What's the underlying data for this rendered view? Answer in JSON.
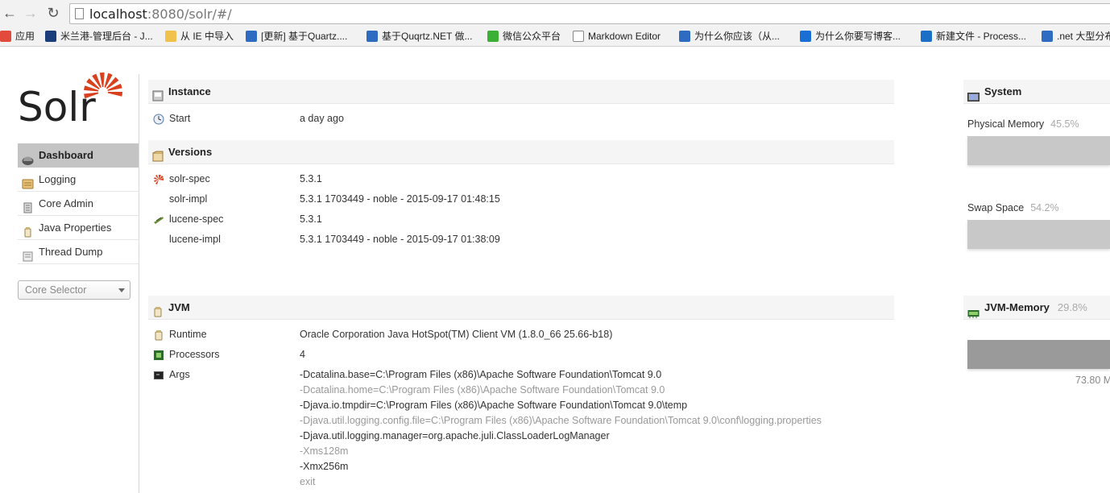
{
  "browser": {
    "url_host": "localhost",
    "url_rest": ":8080/solr/#/",
    "bookmarks": [
      {
        "label": "应用",
        "color": "#e24b3b"
      },
      {
        "label": "米兰港-管理后台 - J...",
        "color": "#1b3d7a"
      },
      {
        "label": "从 IE 中导入",
        "color": "#f0c14b"
      },
      {
        "label": "[更新] 基于Quartz....",
        "color": "#2d6cc0"
      },
      {
        "label": "基于Quqrtz.NET 做...",
        "color": "#2d6cc0"
      },
      {
        "label": "微信公众平台",
        "color": "#3cb034"
      },
      {
        "label": "Markdown Editor",
        "color": "#ffffff"
      },
      {
        "label": "为什么你应该（从...",
        "color": "#2d6cc0"
      },
      {
        "label": "为什么你要写博客...",
        "color": "#1a6fd6"
      },
      {
        "label": "新建文件 - Process...",
        "color": "#1b6fc7"
      },
      {
        "label": ".net 大型分布",
        "color": "#2d6cc0"
      }
    ]
  },
  "logo": {
    "text": "Solr",
    "accent": "#d9411e"
  },
  "sidebar": {
    "items": [
      {
        "label": "Dashboard",
        "icon": "dashboard-icon"
      },
      {
        "label": "Logging",
        "icon": "logging-icon"
      },
      {
        "label": "Core Admin",
        "icon": "core-admin-icon"
      },
      {
        "label": "Java Properties",
        "icon": "java-properties-icon"
      },
      {
        "label": "Thread Dump",
        "icon": "thread-dump-icon"
      }
    ],
    "core_selector": "Core Selector"
  },
  "instance": {
    "title": "Instance",
    "start_label": "Start",
    "start_value": "a day ago"
  },
  "versions": {
    "title": "Versions",
    "rows": [
      {
        "key": "solr-spec",
        "value": "5.3.1"
      },
      {
        "key": "solr-impl",
        "value": "5.3.1 1703449 - noble - 2015-09-17 01:48:15"
      },
      {
        "key": "lucene-spec",
        "value": "5.3.1"
      },
      {
        "key": "lucene-impl",
        "value": "5.3.1 1703449 - noble - 2015-09-17 01:38:09"
      }
    ]
  },
  "jvm": {
    "title": "JVM",
    "runtime_label": "Runtime",
    "runtime_value": "Oracle Corporation Java HotSpot(TM) Client VM (1.8.0_66 25.66-b18)",
    "processors_label": "Processors",
    "processors_value": "4",
    "args_label": "Args",
    "args": [
      "-Dcatalina.base=C:\\Program Files (x86)\\Apache Software Foundation\\Tomcat 9.0",
      "-Dcatalina.home=C:\\Program Files (x86)\\Apache Software Foundation\\Tomcat 9.0",
      "-Djava.io.tmpdir=C:\\Program Files (x86)\\Apache Software Foundation\\Tomcat 9.0\\temp",
      "-Djava.util.logging.config.file=C:\\Program Files (x86)\\Apache Software Foundation\\Tomcat 9.0\\conf\\logging.properties",
      "-Djava.util.logging.manager=org.apache.juli.ClassLoaderLogManager",
      "-Xms128m",
      "-Xmx256m",
      "exit"
    ]
  },
  "system": {
    "title": "System",
    "physical_label": "Physical Memory",
    "physical_pct": "45.5%",
    "swap_label": "Swap Space",
    "swap_pct": "54.2%"
  },
  "jvm_memory": {
    "title": "JVM-Memory",
    "pct": "29.8%",
    "value_partial": "73.80 M"
  }
}
